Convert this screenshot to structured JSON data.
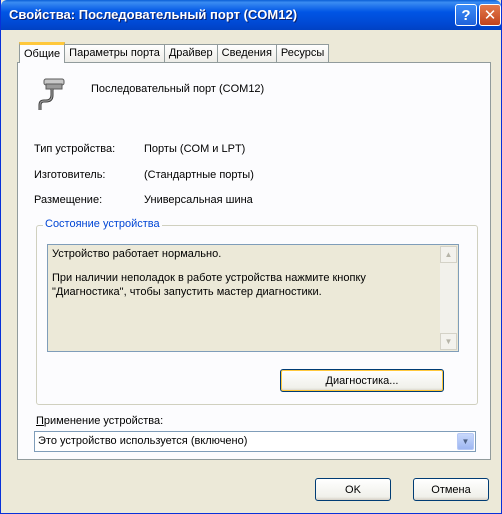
{
  "window": {
    "title": "Свойства: Последовательный порт (COM12)",
    "help_glyph": "?",
    "close_glyph": "✕"
  },
  "tabs": [
    {
      "label": "Общие",
      "active": true
    },
    {
      "label": "Параметры порта",
      "active": false
    },
    {
      "label": "Драйвер",
      "active": false
    },
    {
      "label": "Сведения",
      "active": false
    },
    {
      "label": "Ресурсы",
      "active": false
    }
  ],
  "device": {
    "icon": "serial-port-icon",
    "name": "Последовательный порт (COM12)"
  },
  "properties": [
    {
      "label": "Тип устройства:",
      "value": "Порты (COM и LPT)"
    },
    {
      "label": "Изготовитель:",
      "value": "(Стандартные порты)"
    },
    {
      "label": "Размещение:",
      "value": "Универсальная шина"
    }
  ],
  "status": {
    "group_title": "Состояние устройства",
    "line1": "Устройство работает нормально.",
    "line2": "При наличии неполадок в работе устройства нажмите кнопку \"Диагностика\", чтобы запустить мастер диагностики.",
    "scroll_up": "▲",
    "scroll_down": "▼"
  },
  "diagnostics_button": {
    "label_underlined": "Д",
    "label_rest": "иагностика..."
  },
  "usage": {
    "label_underlined": "П",
    "label_rest": "рименение устройства:",
    "selected_value": "Это устройство используется (включено)",
    "dropdown_glyph": "▼"
  },
  "buttons": {
    "ok": "OK",
    "cancel": "Отмена"
  },
  "colors": {
    "title_bar": "#0055E5",
    "dialog_bg": "#ECE9D8",
    "group_title": "#0046D5",
    "active_tab_accent": "#FFC83C"
  }
}
